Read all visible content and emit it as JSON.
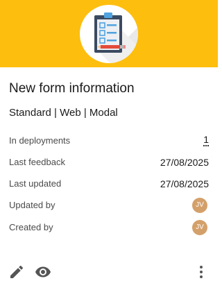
{
  "card": {
    "title": "New form information",
    "subtitle": "Standard | Web | Modal",
    "colors": {
      "banner": "#FDBE0E",
      "avatar": "#D4A06A"
    },
    "details": {
      "deployments_label": "In deployments",
      "deployments_value": "1",
      "last_feedback_label": "Last feedback",
      "last_feedback_value": "27/08/2025",
      "last_updated_label": "Last updated",
      "last_updated_value": "27/08/2025",
      "updated_by_label": "Updated by",
      "updated_by_initials": "JV",
      "created_by_label": "Created by",
      "created_by_initials": "JV"
    },
    "icons": {
      "banner": "clipboard-form-icon",
      "edit": "pencil-icon",
      "preview": "eye-icon",
      "more": "more-vertical-icon"
    }
  }
}
